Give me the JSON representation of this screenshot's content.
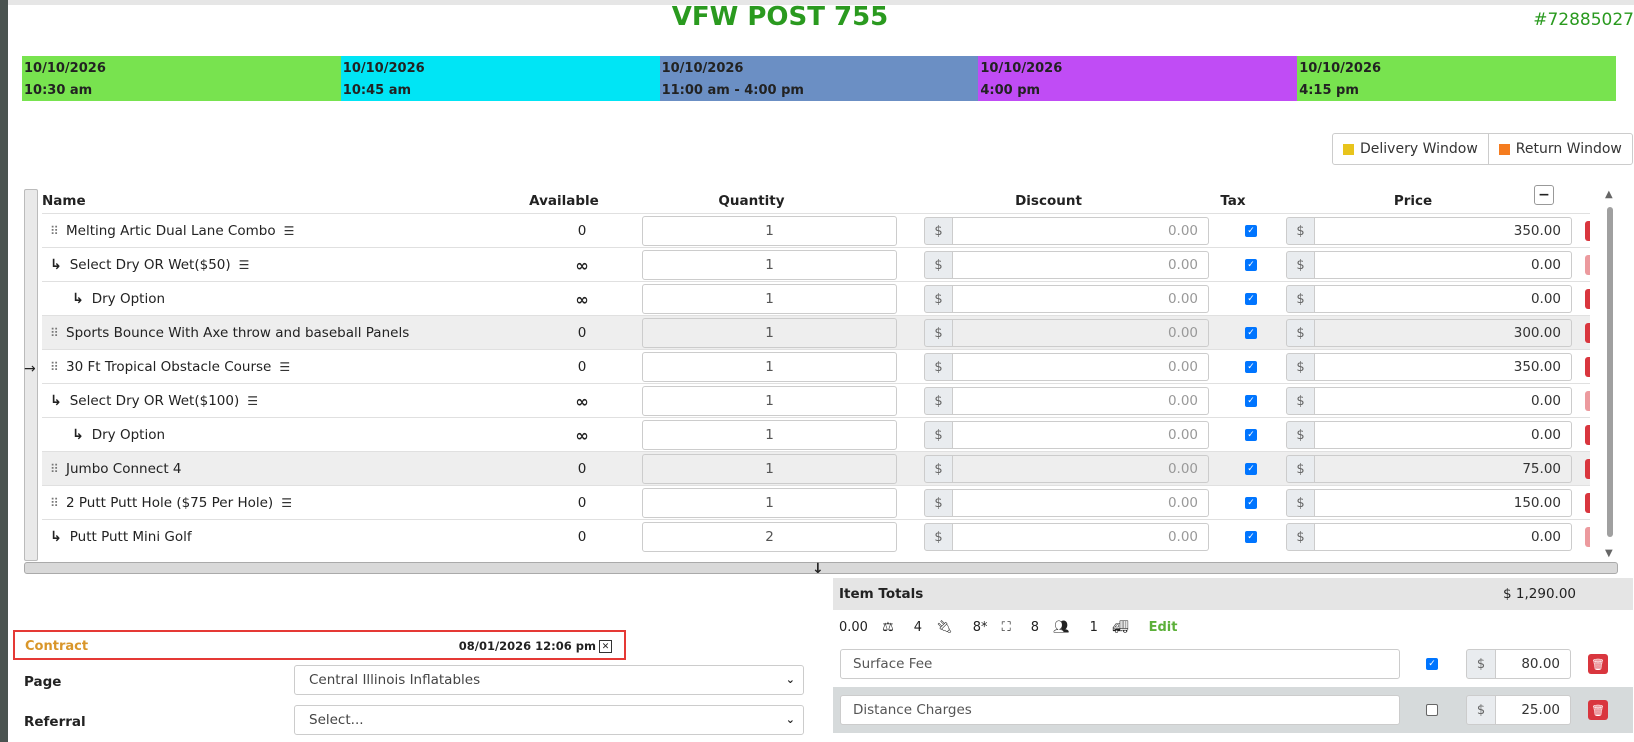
{
  "header": {
    "title": "VFW POST 755",
    "order_id": "#72885027"
  },
  "timeline": [
    {
      "date": "10/10/2026",
      "time": "10:30 am",
      "color": "#78e34f"
    },
    {
      "date": "10/10/2026",
      "time": "10:45 am",
      "color": "#00e5f5"
    },
    {
      "date": "10/10/2026",
      "time": "11:00 am - 4:00 pm",
      "color": "#6b8fc4"
    },
    {
      "date": "10/10/2026",
      "time": "4:00 pm",
      "color": "#c04cf5"
    },
    {
      "date": "10/10/2026",
      "time": "4:15 pm",
      "color": "#78e34f"
    }
  ],
  "windows": {
    "delivery_label": "Delivery Window",
    "delivery_color": "#e8c41c",
    "return_label": "Return Window",
    "return_color": "#f57c1f"
  },
  "table": {
    "headers": {
      "name": "Name",
      "available": "Available",
      "quantity": "Quantity",
      "discount": "Discount",
      "tax": "Tax",
      "price": "Price"
    },
    "currency": "$",
    "rows": [
      {
        "level": 0,
        "name": "Melting Artic Dual Lane Combo",
        "list": true,
        "available": "0",
        "quantity": "1",
        "discount": "0.00",
        "tax": true,
        "price": "350.00",
        "shade": false,
        "del_dim": false
      },
      {
        "level": 1,
        "name": "Select Dry OR Wet($50)",
        "list": true,
        "available": "∞",
        "quantity": "1",
        "discount": "0.00",
        "tax": true,
        "price": "0.00",
        "shade": false,
        "del_dim": true
      },
      {
        "level": 2,
        "name": "Dry Option",
        "list": false,
        "available": "∞",
        "quantity": "1",
        "discount": "0.00",
        "tax": true,
        "price": "0.00",
        "shade": false,
        "del_dim": false
      },
      {
        "level": 0,
        "name": "Sports Bounce With Axe throw and baseball Panels",
        "list": false,
        "available": "0",
        "quantity": "1",
        "discount": "0.00",
        "tax": true,
        "price": "300.00",
        "shade": true,
        "del_dim": false
      },
      {
        "level": 0,
        "name": "30 Ft Tropical Obstacle Course",
        "list": true,
        "available": "0",
        "quantity": "1",
        "discount": "0.00",
        "tax": true,
        "price": "350.00",
        "shade": false,
        "del_dim": false
      },
      {
        "level": 1,
        "name": "Select Dry OR Wet($100)",
        "list": true,
        "available": "∞",
        "quantity": "1",
        "discount": "0.00",
        "tax": true,
        "price": "0.00",
        "shade": false,
        "del_dim": true
      },
      {
        "level": 2,
        "name": "Dry Option",
        "list": false,
        "available": "∞",
        "quantity": "1",
        "discount": "0.00",
        "tax": true,
        "price": "0.00",
        "shade": false,
        "del_dim": false
      },
      {
        "level": 0,
        "name": "Jumbo Connect 4",
        "list": false,
        "available": "0",
        "quantity": "1",
        "discount": "0.00",
        "tax": true,
        "price": "75.00",
        "shade": true,
        "del_dim": false
      },
      {
        "level": 0,
        "name": "2 Putt Putt Hole ($75 Per Hole)",
        "list": true,
        "available": "0",
        "quantity": "1",
        "discount": "0.00",
        "tax": true,
        "price": "150.00",
        "shade": false,
        "del_dim": false
      },
      {
        "level": 1,
        "name": "Putt Putt Mini Golf",
        "list": false,
        "available": "0",
        "quantity": "2",
        "discount": "0.00",
        "tax": true,
        "price": "0.00",
        "shade": false,
        "del_dim": true
      }
    ]
  },
  "totals": {
    "label": "Item Totals",
    "value": "$ 1,290.00",
    "stats": {
      "weight": "0.00",
      "outlets": "4",
      "area": "8*",
      "staff": "8",
      "trucks": "1"
    },
    "edit_label": "Edit"
  },
  "fees": [
    {
      "name": "Surface Fee",
      "checked": true,
      "amount": "80.00",
      "shade": false
    },
    {
      "name": "Distance Charges",
      "checked": false,
      "amount": "25.00",
      "shade": true
    }
  ],
  "contract": {
    "label": "Contract",
    "date": "08/01/2026 12:06 pm"
  },
  "form": {
    "page_label": "Page",
    "page_value": "Central Illinois Inflatables",
    "referral_label": "Referral",
    "referral_value": "Select..."
  }
}
